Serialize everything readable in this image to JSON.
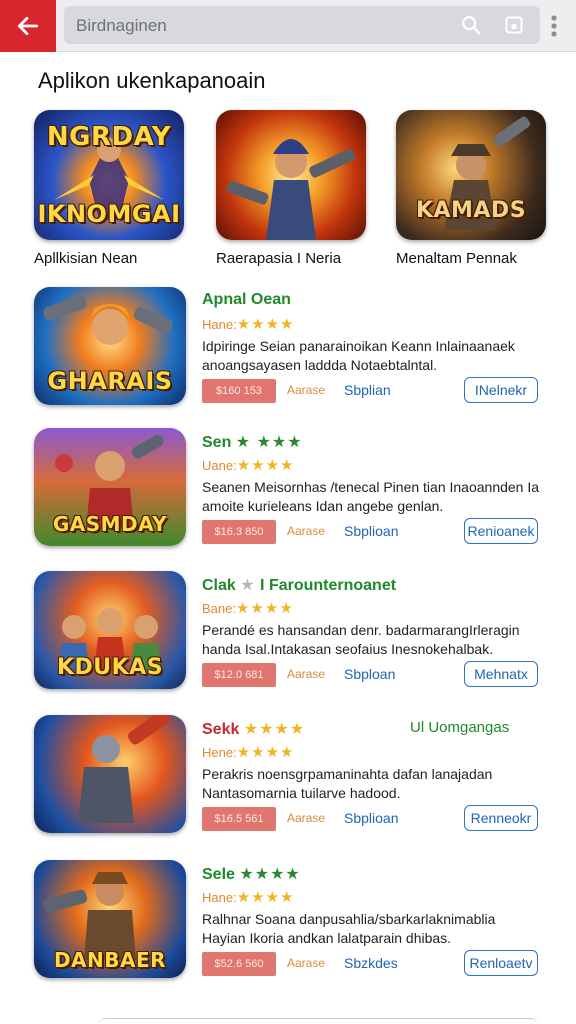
{
  "header": {
    "search_text": "Birdnaginen"
  },
  "section": {
    "title": "Aplikon ukenkapanoain"
  },
  "featured": [
    {
      "name": "Apllkisian Nean",
      "art_line1": "NGRDAY",
      "art_line2": "IKNOMGAI",
      "colors": [
        "#1c3f9e",
        "#e86a1a"
      ]
    },
    {
      "name": "Raerapasia I Neria",
      "art_line1": "",
      "art_line2": "",
      "colors": [
        "#f39a1d",
        "#7a1506"
      ]
    },
    {
      "name": "Menaltam Pennak",
      "art_line1": "",
      "art_line2": "KAMADS",
      "colors": [
        "#3a2a1c",
        "#d98a2b"
      ]
    }
  ],
  "apps": [
    {
      "title": "Apnal Oean",
      "title_stars": "",
      "extra": "",
      "rating_label": "Hane:",
      "rating_stars": "★★★★",
      "desc": "Idpiringe Seian panarainoikan Keann Inlainaanaek anoangsayasen laddda Notaebtalntal.",
      "price": "$160 153",
      "small_label": "Aarase",
      "store": "Sbplian",
      "action": "INelnekr",
      "art": "GHARAIS",
      "colors": [
        "#1b7bc8",
        "#ef7d1f"
      ]
    },
    {
      "title": "Sen",
      "title_stars": "★ ★★★",
      "extra": "",
      "rating_label": "Uane:",
      "rating_stars": "★★★★",
      "desc": "Seanen Meisornhas /tenecal Pinen tian Inaoannden Ia amoite kurieleans Idan angebe genlan.",
      "price": "$16.3 850",
      "small_label": "Aarase",
      "store": "Sbplioan",
      "action": "Renioanek",
      "art": "GASMDAY",
      "colors": [
        "#6a3fa3",
        "#4b8f2a"
      ]
    },
    {
      "title": "Clak",
      "title_stars": "★",
      "extra": "I Farounternoanet",
      "rating_label": "Bane:",
      "rating_stars": "★★★★",
      "desc": "Perandé es hansandan denr. badarmarangIrleragin handa Isal.Intakasan seofaius Inesnokehalbak.",
      "price": "$12.0 681",
      "small_label": "Aarase",
      "store": "Sbploan",
      "action": "Mehnatx",
      "art": "KDUKAS",
      "colors": [
        "#2c5cae",
        "#e25a20"
      ]
    },
    {
      "title": "Sekk",
      "title_stars": "★★★★",
      "extra": "Ul Uomgangas",
      "rating_label": "Hene:",
      "rating_stars": "★★★★",
      "desc": "Perakris noensgrpamaninahta dafan lanajadan Nantasomarnia tuilarve hadood.",
      "price": "$16.5 561",
      "small_label": "Aarase",
      "store": "Sbplioan",
      "action": "Renneokr",
      "art": "",
      "colors": [
        "#1e56a8",
        "#e06a1c"
      ]
    },
    {
      "title": "Sele",
      "title_stars": "★★★★",
      "extra": "",
      "rating_label": "Hane:",
      "rating_stars": "★★★★",
      "desc": "Ralhnar Soana danpusahlia/sbarkarlaknimablia Hayian Ikoria andkan lalatparain dhibas.",
      "price": "$52.6 560",
      "small_label": "Aarase",
      "store": "Sbzkdes",
      "action": "Renloaetv",
      "art": "DANBAER",
      "colors": [
        "#1c4a9a",
        "#d86c1a"
      ]
    }
  ]
}
